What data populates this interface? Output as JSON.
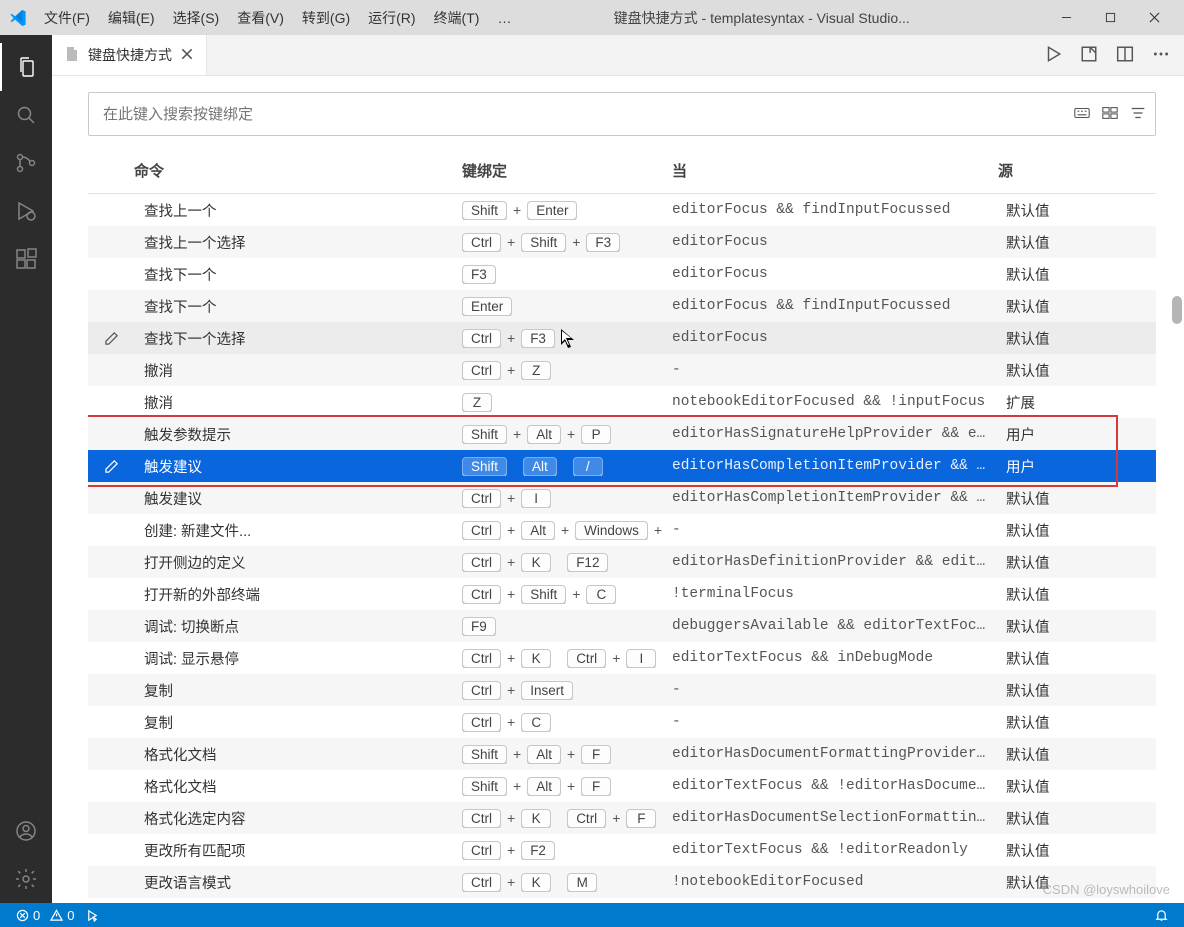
{
  "title": "键盘快捷方式 - templatesyntax - Visual Studio...",
  "menu": [
    "文件(F)",
    "编辑(E)",
    "选择(S)",
    "查看(V)",
    "转到(G)",
    "运行(R)",
    "终端(T)",
    "…"
  ],
  "tab": {
    "label": "键盘快捷方式"
  },
  "search": {
    "placeholder": "在此键入搜索按键绑定"
  },
  "headers": {
    "cmd": "命令",
    "kb": "键绑定",
    "when": "当",
    "src": "源"
  },
  "rows": [
    {
      "cmd": "查找上一个",
      "keys": [
        "Shift",
        "+",
        "Enter"
      ],
      "when": "editorFocus && findInputFocussed",
      "src": "默认值"
    },
    {
      "cmd": "查找上一个选择",
      "keys": [
        "Ctrl",
        "+",
        "Shift",
        "+",
        "F3"
      ],
      "when": "editorFocus",
      "src": "默认值"
    },
    {
      "cmd": "查找下一个",
      "keys": [
        "F3"
      ],
      "when": "editorFocus",
      "src": "默认值"
    },
    {
      "cmd": "查找下一个",
      "keys": [
        "Enter"
      ],
      "when": "editorFocus && findInputFocussed",
      "src": "默认值"
    },
    {
      "cmd": "查找下一个选择",
      "keys": [
        "Ctrl",
        "+",
        "F3"
      ],
      "when": "editorFocus",
      "src": "默认值",
      "pencil": true,
      "hover": true
    },
    {
      "cmd": "撤消",
      "keys": [
        "Ctrl",
        "+",
        "Z"
      ],
      "when": "-",
      "src": "默认值"
    },
    {
      "cmd": "撤消",
      "keys": [
        "Z"
      ],
      "when": "notebookEditorFocused && !inputFocus",
      "src": "扩展"
    },
    {
      "cmd": "触发参数提示",
      "keys": [
        "Shift",
        "+",
        "Alt",
        "+",
        "P"
      ],
      "when": "editorHasSignatureHelpProvider && e…",
      "src": "用户"
    },
    {
      "cmd": "触发建议",
      "keys": [
        "Shift",
        " ",
        "Alt",
        " ",
        "/"
      ],
      "when": "editorHasCompletionItemProvider && …",
      "src": "用户",
      "pencil": true,
      "selected": true
    },
    {
      "cmd": "触发建议",
      "keys": [
        "Ctrl",
        "+",
        "I"
      ],
      "when": "editorHasCompletionItemProvider && …",
      "src": "默认值"
    },
    {
      "cmd": "创建: 新建文件...",
      "keys": [
        "Ctrl",
        "+",
        "Alt",
        "+",
        "Windows",
        "+"
      ],
      "when": "-",
      "src": "默认值"
    },
    {
      "cmd": "打开侧边的定义",
      "keys": [
        "Ctrl",
        "+",
        "K",
        " ",
        "F12"
      ],
      "when": "editorHasDefinitionProvider && edit…",
      "src": "默认值"
    },
    {
      "cmd": "打开新的外部终端",
      "keys": [
        "Ctrl",
        "+",
        "Shift",
        "+",
        "C"
      ],
      "when": "!terminalFocus",
      "src": "默认值"
    },
    {
      "cmd": "调试: 切换断点",
      "keys": [
        "F9"
      ],
      "when": "debuggersAvailable && editorTextFoc…",
      "src": "默认值"
    },
    {
      "cmd": "调试: 显示悬停",
      "keys": [
        "Ctrl",
        "+",
        "K",
        " ",
        "Ctrl",
        "+",
        "I"
      ],
      "when": "editorTextFocus && inDebugMode",
      "src": "默认值"
    },
    {
      "cmd": "复制",
      "keys": [
        "Ctrl",
        "+",
        "Insert"
      ],
      "when": "-",
      "src": "默认值"
    },
    {
      "cmd": "复制",
      "keys": [
        "Ctrl",
        "+",
        "C"
      ],
      "when": "-",
      "src": "默认值"
    },
    {
      "cmd": "格式化文档",
      "keys": [
        "Shift",
        "+",
        "Alt",
        "+",
        "F"
      ],
      "when": "editorHasDocumentFormattingProvider…",
      "src": "默认值"
    },
    {
      "cmd": "格式化文档",
      "keys": [
        "Shift",
        "+",
        "Alt",
        "+",
        "F"
      ],
      "when": "editorTextFocus && !editorHasDocume…",
      "src": "默认值"
    },
    {
      "cmd": "格式化选定内容",
      "keys": [
        "Ctrl",
        "+",
        "K",
        " ",
        "Ctrl",
        "+",
        "F"
      ],
      "when": "editorHasDocumentSelectionFormattin…",
      "src": "默认值"
    },
    {
      "cmd": "更改所有匹配项",
      "keys": [
        "Ctrl",
        "+",
        "F2"
      ],
      "when": "editorTextFocus && !editorReadonly",
      "src": "默认值"
    },
    {
      "cmd": "更改语言模式",
      "keys": [
        "Ctrl",
        "+",
        "K",
        " ",
        "M"
      ],
      "when": "!notebookEditorFocused",
      "src": "默认值"
    }
  ],
  "status": {
    "errors": "0",
    "warnings": "0"
  },
  "watermark": "CSDN @loyswhoilove"
}
